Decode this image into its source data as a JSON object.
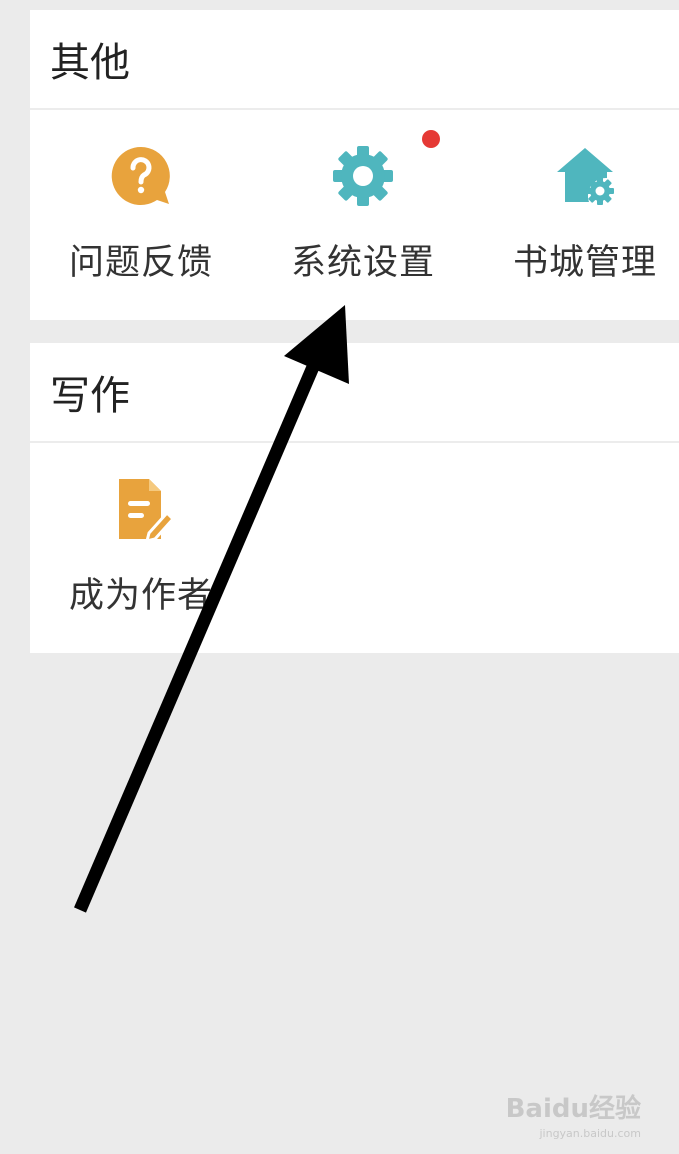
{
  "sections": {
    "other": {
      "title": "其他",
      "items": [
        {
          "label": "问题反馈",
          "icon": "feedback-question-icon"
        },
        {
          "label": "系统设置",
          "icon": "gear-icon",
          "has_notification_dot": true
        },
        {
          "label": "书城管理",
          "icon": "store-settings-icon"
        }
      ]
    },
    "writing": {
      "title": "写作",
      "items": [
        {
          "label": "成为作者",
          "icon": "edit-document-icon"
        }
      ]
    }
  },
  "colors": {
    "orange_icon": "#e8a33d",
    "teal_icon": "#4fb6be",
    "notification_dot": "#e53935",
    "background": "#ebebeb",
    "arrow": "#000000"
  },
  "watermark": {
    "brand": "Baidu经验",
    "sub": "jingyan.baidu.com"
  }
}
